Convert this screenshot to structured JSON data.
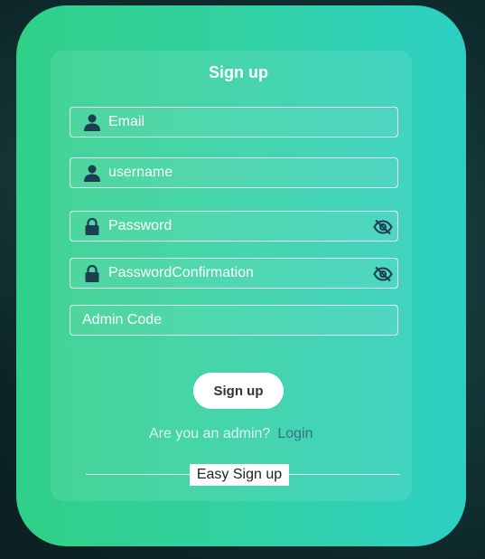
{
  "form": {
    "title": "Sign up",
    "email_placeholder": "Email",
    "username_placeholder": "username",
    "password_placeholder": "Password",
    "password_confirmation_placeholder": "PasswordConfirmation",
    "admin_code_placeholder": "Admin Code",
    "submit_label": "Sign up",
    "admin_question": "Are you an admin?",
    "login_link": "Login",
    "easy_signup_label": "Easy Sign up"
  },
  "icons": {
    "email": "user-icon",
    "username": "user-icon",
    "password": "lock-icon",
    "password_confirmation": "lock-icon",
    "visibility_toggle": "eye-slash-icon"
  },
  "colors": {
    "card_start": "#2fd087",
    "card_end": "#2dcfc2",
    "icon": "#1d3d52",
    "login_link": "#3a6f7e"
  }
}
